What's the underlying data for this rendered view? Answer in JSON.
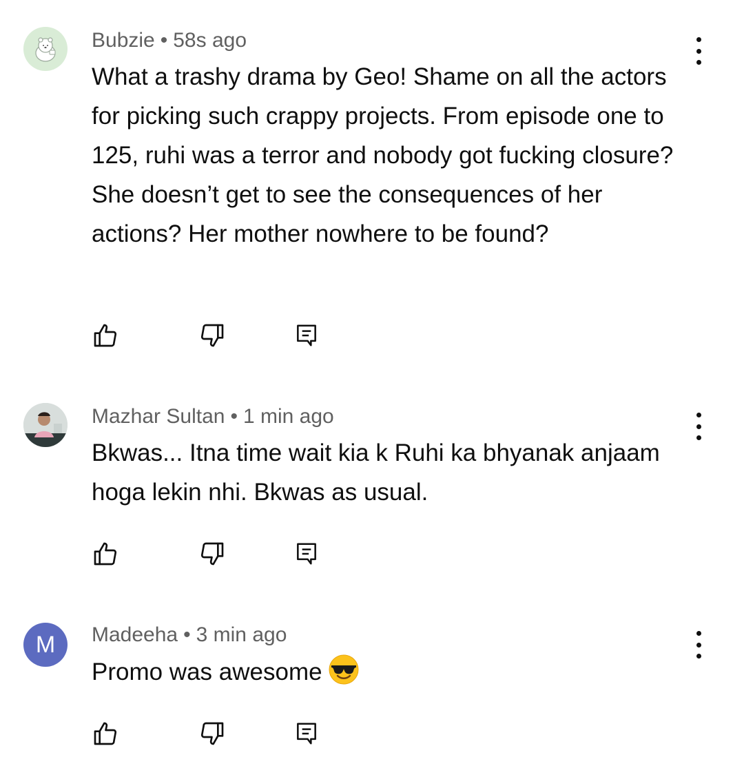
{
  "comments": [
    {
      "author": "Bubzie",
      "separator": "•",
      "time": "58s ago",
      "text": "What a trashy drama by Geo! Shame on all the actors for picking such crappy projects. From episode one to 125, ruhi was a terror and nobody got fucking closure? She doesn’t get to see the consequences of her actions? Her mother nowhere to be found?",
      "avatar": {
        "type": "illustration",
        "bg": "#d9ecd6"
      }
    },
    {
      "author": "Mazhar Sultan",
      "separator": "•",
      "time": "1 min ago",
      "text": "Bkwas... Itna time wait kia k Ruhi ka bhyanak anjaam hoga lekin nhi. Bkwas as usual.",
      "avatar": {
        "type": "photo",
        "bg": "#cfd6d4"
      }
    },
    {
      "author": "Madeeha",
      "separator": "•",
      "time": "3 min ago",
      "text": "Promo was awesome",
      "emoji": "😎",
      "avatar": {
        "type": "letter",
        "letter": "M",
        "bg": "#5c6bc0"
      }
    }
  ],
  "icons": {
    "like": "thumbs-up-icon",
    "dislike": "thumbs-down-icon",
    "reply": "reply-icon",
    "menu": "more-vert-icon"
  },
  "colors": {
    "text": "#0f0f0f",
    "meta": "#606060"
  }
}
